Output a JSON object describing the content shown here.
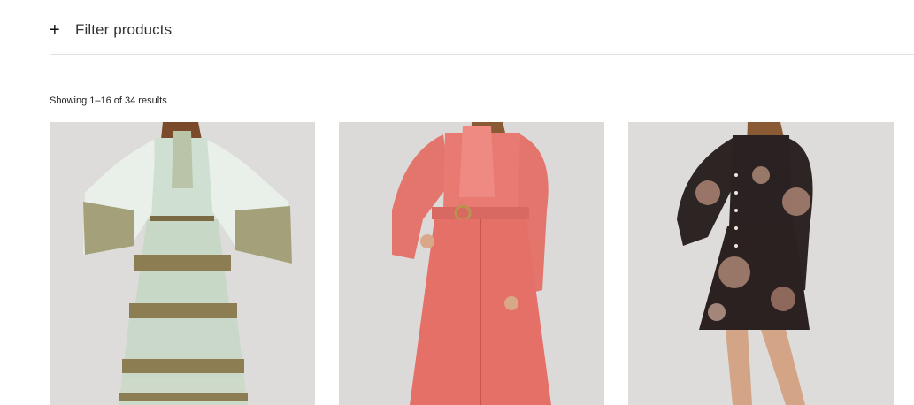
{
  "filter": {
    "toggle_symbol": "+",
    "label": "Filter products"
  },
  "results": {
    "text": "Showing 1–16 of 34 results"
  },
  "products": [
    {
      "dress_color": "#c7d8c7",
      "accent": "#8a7a4a",
      "description_icon": "product-photo"
    },
    {
      "dress_color": "#e5736c",
      "accent": "#d0645d",
      "description_icon": "product-photo"
    },
    {
      "dress_color": "#2a2222",
      "accent": "#a87a6a",
      "description_icon": "product-photo"
    }
  ],
  "colors": {
    "background": "#ffffff",
    "photo_background": "#dcdad8",
    "divider": "#e2e2e2",
    "text": "#222222"
  }
}
